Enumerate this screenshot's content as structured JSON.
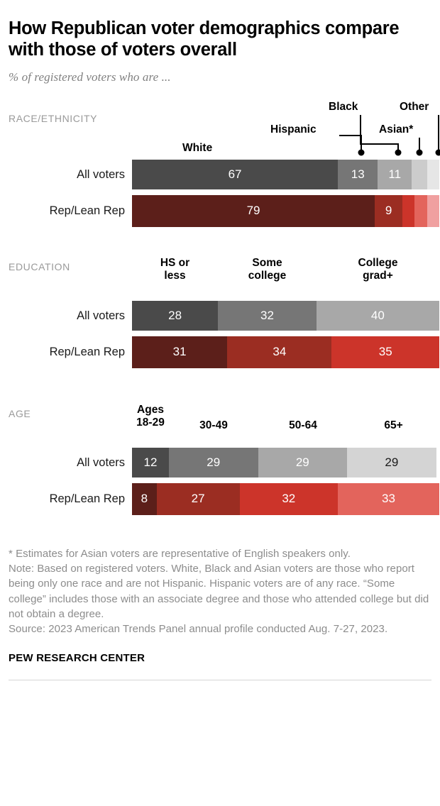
{
  "header": {
    "title": "How Republican voter demographics compare with those of voters overall",
    "subtitle": "% of registered voters who are ..."
  },
  "sections": {
    "race": {
      "label": "RACE/ETHNICITY",
      "leader_labels": {
        "white": "White",
        "hispanic": "Hispanic",
        "black": "Black",
        "asian": "Asian*",
        "other": "Other"
      },
      "rows": {
        "all": "All voters",
        "rep": "Rep/Lean Rep"
      }
    },
    "education": {
      "label": "EDUCATION",
      "headers": [
        "HS or\nless",
        "Some\ncollege",
        "College\ngrad+"
      ],
      "rows": {
        "all": "All voters",
        "rep": "Rep/Lean Rep"
      }
    },
    "age": {
      "label": "AGE",
      "headers": [
        "Ages\n18-29",
        "30-49",
        "50-64",
        "65+"
      ],
      "rows": {
        "all": "All voters",
        "rep": "Rep/Lean Rep"
      }
    }
  },
  "footer": {
    "note_asterisk": "* Estimates for Asian voters are representative of English speakers only.",
    "note": "Note: Based on registered voters. White, Black and Asian voters are those who report being only one race and are not Hispanic. Hispanic voters are of any race. “Some college” includes those with an associate degree and those who attended college but did not obtain a degree.",
    "source": "Source: 2023 American Trends Panel annual profile conducted Aug. 7-27, 2023.",
    "brand": "PEW RESEARCH CENTER"
  },
  "colors": {
    "gray_1": "#4a4a4a",
    "gray_2": "#767676",
    "gray_3": "#a8a8a8",
    "gray_4": "#cccccc",
    "gray_5": "#e6e6e6",
    "red_1": "#5c1f1a",
    "red_2": "#9b2d22",
    "red_3": "#cc342a",
    "red_4": "#e3645c",
    "red_5": "#f0a0a0"
  },
  "chart_data": [
    {
      "type": "bar",
      "title": "RACE/ETHNICITY",
      "subtype": "stacked-horizontal-100",
      "categories": [
        "White",
        "Hispanic",
        "Black",
        "Asian*",
        "Other"
      ],
      "series": [
        {
          "name": "All voters",
          "values": [
            67,
            13,
            11,
            5,
            4
          ],
          "labels": [
            "67",
            "13",
            "11",
            "",
            ""
          ],
          "colors": [
            "#4a4a4a",
            "#767676",
            "#a8a8a8",
            "#cccccc",
            "#e6e6e6"
          ]
        },
        {
          "name": "Rep/Lean Rep",
          "values": [
            79,
            9,
            4,
            4,
            4
          ],
          "labels": [
            "79",
            "9",
            "",
            "",
            ""
          ],
          "colors": [
            "#5c1f1a",
            "#9b2d22",
            "#cc342a",
            "#e3645c",
            "#f0a0a0"
          ]
        }
      ],
      "xlabel": "",
      "ylabel": "",
      "xlim": [
        0,
        100
      ],
      "grid": false,
      "legend": "leader-lines"
    },
    {
      "type": "bar",
      "title": "EDUCATION",
      "subtype": "stacked-horizontal-100",
      "categories": [
        "HS or less",
        "Some college",
        "College grad+"
      ],
      "series": [
        {
          "name": "All voters",
          "values": [
            28,
            32,
            40
          ],
          "labels": [
            "28",
            "32",
            "40"
          ],
          "colors": [
            "#4a4a4a",
            "#767676",
            "#a8a8a8"
          ]
        },
        {
          "name": "Rep/Lean Rep",
          "values": [
            31,
            34,
            35
          ],
          "labels": [
            "31",
            "34",
            "35"
          ],
          "colors": [
            "#5c1f1a",
            "#9b2d22",
            "#cc342a"
          ]
        }
      ],
      "xlabel": "",
      "ylabel": "",
      "xlim": [
        0,
        100
      ],
      "grid": false,
      "legend": "column-headers"
    },
    {
      "type": "bar",
      "title": "AGE",
      "subtype": "stacked-horizontal-100",
      "categories": [
        "Ages 18-29",
        "30-49",
        "50-64",
        "65+"
      ],
      "series": [
        {
          "name": "All voters",
          "values": [
            12,
            29,
            29,
            29
          ],
          "labels": [
            "12",
            "29",
            "29",
            "29"
          ],
          "colors": [
            "#4a4a4a",
            "#767676",
            "#a8a8a8",
            "#d4d4d4"
          ]
        },
        {
          "name": "Rep/Lean Rep",
          "values": [
            8,
            27,
            32,
            33
          ],
          "labels": [
            "8",
            "27",
            "32",
            "33"
          ],
          "colors": [
            "#5c1f1a",
            "#9b2d22",
            "#cc342a",
            "#e3645c"
          ]
        }
      ],
      "xlabel": "",
      "ylabel": "",
      "xlim": [
        0,
        100
      ],
      "grid": false,
      "legend": "column-headers"
    }
  ]
}
